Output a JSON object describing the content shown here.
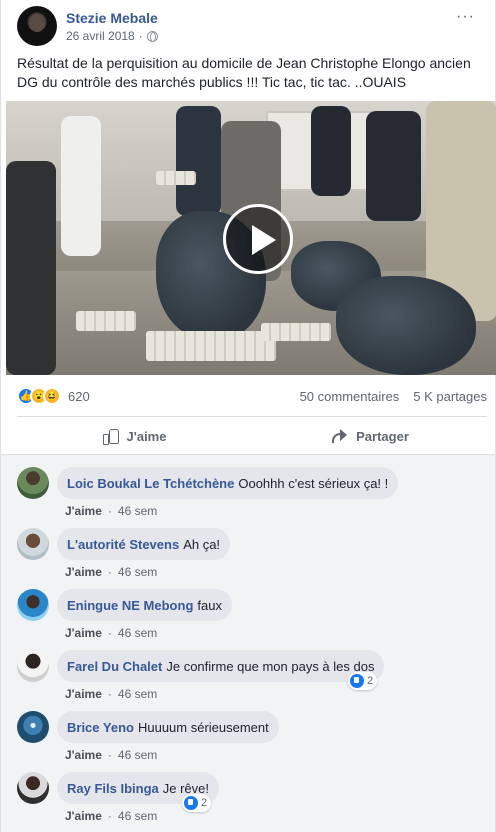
{
  "post": {
    "author": "Stezie Mebale",
    "date": "26 avril 2018",
    "more": "···",
    "text": "Résultat de la perquisition au domicile de Jean Christophe Elongo ancien DG du contrôle des marchés publics !!! Tic tac, tic tac. ..OUAIS"
  },
  "video": {
    "play_icon": "play-icon"
  },
  "stats": {
    "reaction_icons": [
      "like-icon",
      "wow-icon",
      "haha-icon"
    ],
    "reaction_count": "620",
    "comments": "50 commentaires",
    "shares": "5 K partages"
  },
  "actions": {
    "like": "J'aime",
    "share": "Partager"
  },
  "comments": [
    {
      "name": "Loic Boukal Le Tchétchène",
      "text": "Ooohhh c'est sérieux ça! !",
      "like": "J'aime",
      "time": "46 sem",
      "reactions": ""
    },
    {
      "name": "L'autorité Stevens",
      "text": "Ah ça!",
      "like": "J'aime",
      "time": "46 sem",
      "reactions": ""
    },
    {
      "name": "Eningue NE Mebong",
      "text": "faux",
      "like": "J'aime",
      "time": "46 sem",
      "reactions": ""
    },
    {
      "name": "Farel Du Chalet",
      "text": "Je confirme que mon pays à les dos",
      "like": "J'aime",
      "time": "46 sem",
      "reactions": "2"
    },
    {
      "name": "Brice Yeno",
      "text": "Huuuum sérieusement",
      "like": "J'aime",
      "time": "46 sem",
      "reactions": ""
    },
    {
      "name": "Ray Fils Ibinga",
      "text": "Je rêve!",
      "like": "J'aime",
      "time": "46 sem",
      "reactions": "2"
    }
  ],
  "colors": {
    "link": "#385898",
    "like_blue": "#1877f2",
    "bubble": "#e4e6eb"
  }
}
